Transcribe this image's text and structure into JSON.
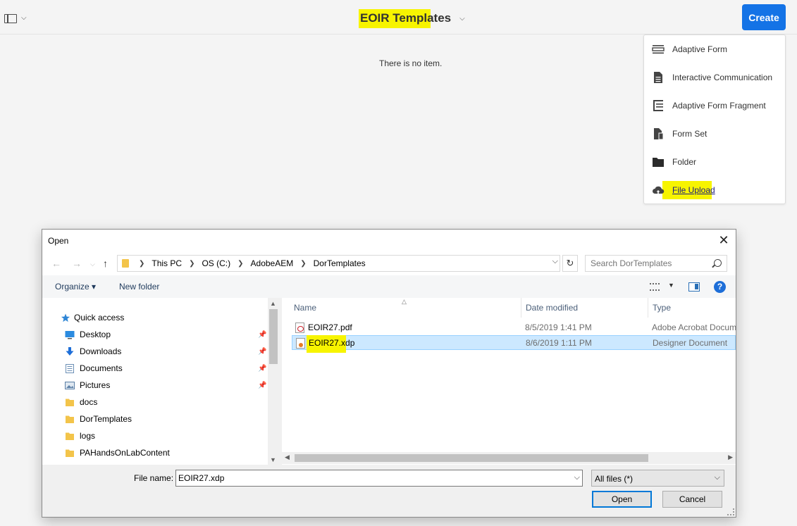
{
  "topbar": {
    "title": "EOIR Templates",
    "create_label": "Create",
    "accent_color": "#1473e6",
    "highlight_color": "#f7f400"
  },
  "content": {
    "empty_message": "There is no item."
  },
  "create_menu": {
    "items": [
      {
        "label": "Adaptive Form",
        "icon": "adaptive-form-icon"
      },
      {
        "label": "Interactive Communication",
        "icon": "document-icon"
      },
      {
        "label": "Adaptive Form Fragment",
        "icon": "form-fragment-icon"
      },
      {
        "label": "Form Set",
        "icon": "form-set-icon"
      },
      {
        "label": "Folder",
        "icon": "folder-icon"
      },
      {
        "label": "File Upload",
        "icon": "cloud-upload-icon"
      }
    ]
  },
  "dialog": {
    "title": "Open",
    "breadcrumb": [
      "This PC",
      "OS (C:)",
      "AdobeAEM",
      "DorTemplates"
    ],
    "search_placeholder": "Search DorTemplates",
    "organize_label": "Organize ▾",
    "new_folder_label": "New folder",
    "nav_items": [
      {
        "label": "Quick access",
        "icon": "star-icon",
        "pinned": false
      },
      {
        "label": "Desktop",
        "icon": "desktop-icon",
        "pinned": true
      },
      {
        "label": "Downloads",
        "icon": "download-icon",
        "pinned": true
      },
      {
        "label": "Documents",
        "icon": "documents-icon",
        "pinned": true
      },
      {
        "label": "Pictures",
        "icon": "pictures-icon",
        "pinned": true
      },
      {
        "label": "docs",
        "icon": "folder-icon",
        "pinned": false
      },
      {
        "label": "DorTemplates",
        "icon": "folder-icon",
        "pinned": false
      },
      {
        "label": "logs",
        "icon": "folder-icon",
        "pinned": false
      },
      {
        "label": "PAHandsOnLabContent",
        "icon": "folder-icon",
        "pinned": false
      }
    ],
    "columns": {
      "name": "Name",
      "date": "Date modified",
      "type": "Type"
    },
    "files": [
      {
        "name": "EOIR27.pdf",
        "date": "8/5/2019 1:41 PM",
        "type": "Adobe Acrobat Docum",
        "icon": "pdf-file-icon",
        "selected": false
      },
      {
        "name": "EOIR27.xdp",
        "date": "8/6/2019 1:11 PM",
        "type": "Designer Document",
        "icon": "xdp-file-icon",
        "selected": true
      }
    ],
    "file_name_label": "File name:",
    "file_name_value": "EOIR27.xdp",
    "file_type_filter": "All files (*)",
    "open_label": "Open",
    "cancel_label": "Cancel"
  }
}
